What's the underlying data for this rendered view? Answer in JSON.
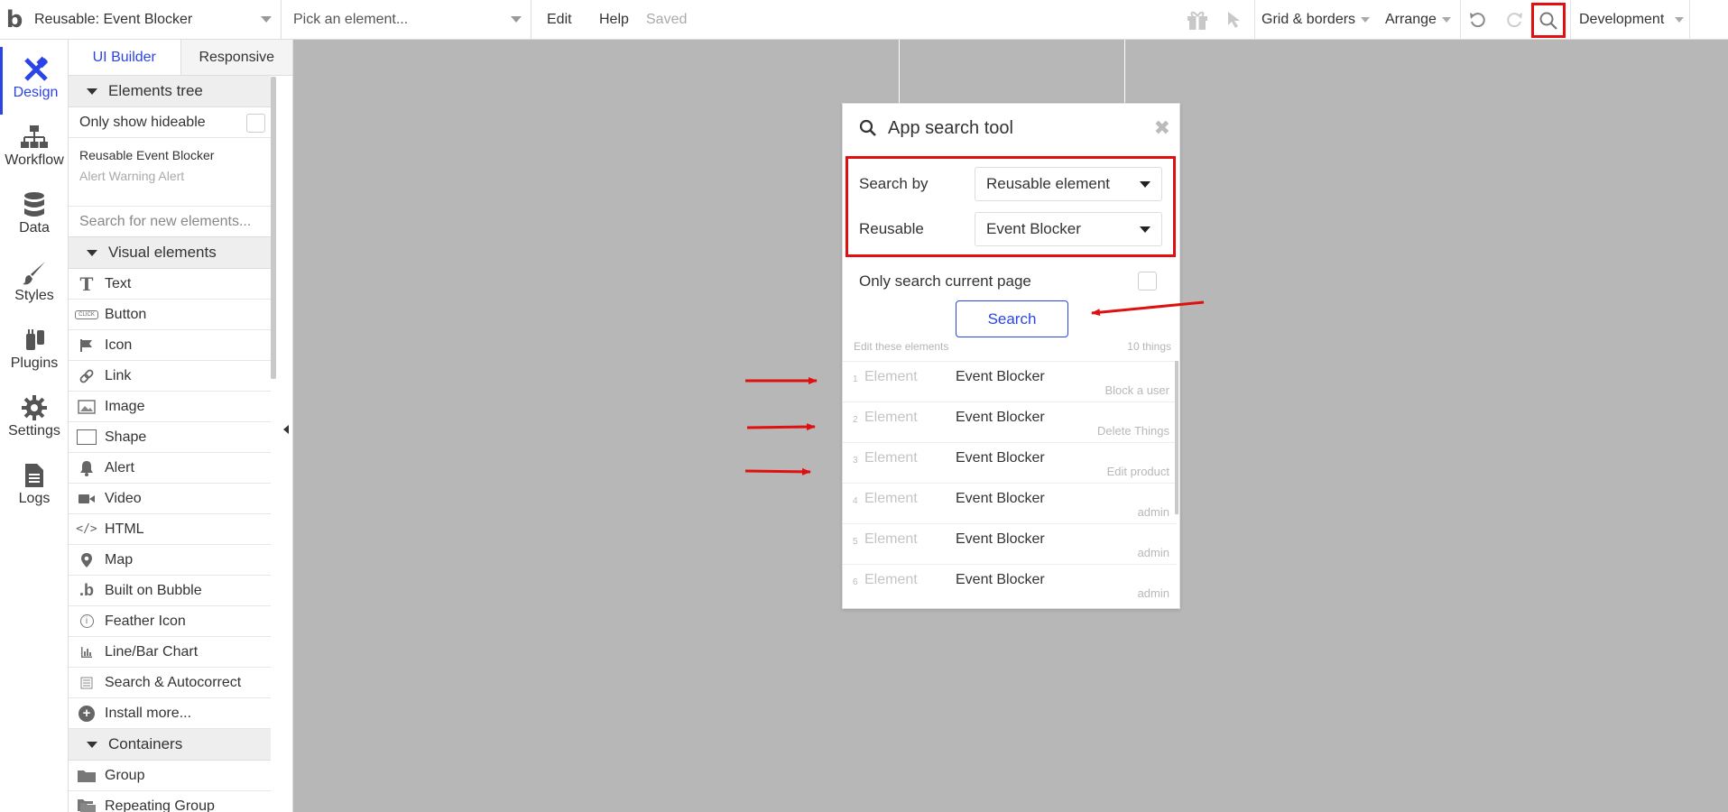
{
  "topbar": {
    "logo": "b",
    "page_selector": "Reusable: Event Blocker",
    "element_picker": "Pick an element...",
    "menu_edit": "Edit",
    "menu_help": "Help",
    "status": "Saved",
    "grid_menu": "Grid & borders",
    "arrange_menu": "Arrange",
    "environment": "Development"
  },
  "leftnav": {
    "items": [
      {
        "label": "Design",
        "icon": "design-icon",
        "active": true
      },
      {
        "label": "Workflow",
        "icon": "workflow-icon"
      },
      {
        "label": "Data",
        "icon": "database-icon"
      },
      {
        "label": "Styles",
        "icon": "brush-icon"
      },
      {
        "label": "Plugins",
        "icon": "plug-icon"
      },
      {
        "label": "Settings",
        "icon": "gear-icon"
      },
      {
        "label": "Logs",
        "icon": "document-icon"
      }
    ]
  },
  "panel": {
    "tab_builder": "UI Builder",
    "tab_responsive": "Responsive",
    "tree_header": "Elements tree",
    "only_hideable": "Only show hideable",
    "tree_item_1": "Reusable Event Blocker",
    "tree_item_2": "Alert Warning Alert",
    "search_placeholder": "Search for new elements...",
    "visual_header": "Visual elements",
    "visual_elements": [
      {
        "label": "Text",
        "icon": "text-icon"
      },
      {
        "label": "Button",
        "icon": "button-icon"
      },
      {
        "label": "Icon",
        "icon": "flag-icon"
      },
      {
        "label": "Link",
        "icon": "link-icon"
      },
      {
        "label": "Image",
        "icon": "image-icon"
      },
      {
        "label": "Shape",
        "icon": "shape-icon"
      },
      {
        "label": "Alert",
        "icon": "bell-icon"
      },
      {
        "label": "Video",
        "icon": "video-icon"
      },
      {
        "label": "HTML",
        "icon": "code-icon"
      },
      {
        "label": "Map",
        "icon": "map-pin-icon"
      },
      {
        "label": "Built on Bubble",
        "icon": "bubble-logo-icon"
      },
      {
        "label": "Feather Icon",
        "icon": "info-circle-icon"
      },
      {
        "label": "Line/Bar Chart",
        "icon": "bar-chart-icon"
      },
      {
        "label": "Search & Autocorrect",
        "icon": "list-icon"
      },
      {
        "label": "Install more...",
        "icon": "plus-circle-icon"
      }
    ],
    "containers_header": "Containers",
    "containers": [
      {
        "label": "Group",
        "icon": "folder-icon"
      },
      {
        "label": "Repeating Group",
        "icon": "folders-icon"
      }
    ]
  },
  "dialog": {
    "title": "App search tool",
    "search_by_label": "Search by",
    "search_by_value": "Reusable element",
    "reusable_label": "Reusable",
    "reusable_value": "Event Blocker",
    "only_current_page": "Only search current page",
    "search_button": "Search",
    "results_caption": "Edit these elements",
    "results_count": "10 things",
    "results": [
      {
        "num": "1",
        "type": "Element",
        "name": "Event Blocker",
        "context": "Block a user"
      },
      {
        "num": "2",
        "type": "Element",
        "name": "Event Blocker",
        "context": "Delete Things"
      },
      {
        "num": "3",
        "type": "Element",
        "name": "Event Blocker",
        "context": "Edit product"
      },
      {
        "num": "4",
        "type": "Element",
        "name": "Event Blocker",
        "context": "admin"
      },
      {
        "num": "5",
        "type": "Element",
        "name": "Event Blocker",
        "context": "admin"
      },
      {
        "num": "6",
        "type": "Element",
        "name": "Event Blocker",
        "context": "admin"
      }
    ]
  },
  "colors": {
    "accent": "#2b44e6",
    "highlight": "#e01010",
    "canvas": "#b7b7b7"
  }
}
